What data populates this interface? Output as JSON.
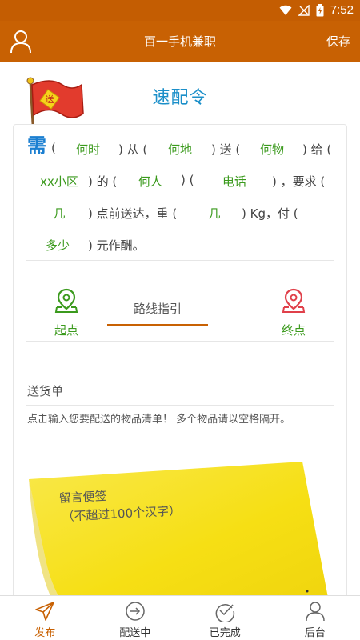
{
  "status_bar": {
    "time": "7:52",
    "icons": [
      "wifi-icon",
      "signal-off-icon",
      "battery-charging-icon"
    ]
  },
  "header": {
    "title": "百一手机兼职",
    "save_label": "保存",
    "user_icon": "user-icon"
  },
  "page": {
    "title": "速配令",
    "flag_char": "送",
    "need_char": "需"
  },
  "order_form": {
    "open_paren": "(",
    "from_text": ") 从 (",
    "send_text": ") 送 (",
    "give_text": ") 给 (",
    "of_text": ") 的 (",
    "paren_mid": ") (",
    "require_text": ") ，要求 (",
    "deliver_text": ") 点前送达，重 (",
    "weight_unit_text": ") Kg，付 (",
    "reward_text": ") 元作酬。",
    "slots": {
      "when": "何时",
      "where": "何地",
      "what": "何物",
      "community": "xx小区",
      "who": "何人",
      "phone": "电话",
      "hour": "几",
      "weight": "几",
      "pay": "多少"
    }
  },
  "route": {
    "start_label": "起点",
    "title": "路线指引",
    "end_label": "终点"
  },
  "delivery": {
    "label": "送货单",
    "hint": "点击输入您要配送的物品清单！ 多个物品请以空格隔开。"
  },
  "note": {
    "title": "留言便签",
    "subtitle": "（不超过100个汉字）"
  },
  "bottom_nav": [
    {
      "label": "发布",
      "icon": "send-icon",
      "active": true
    },
    {
      "label": "配送中",
      "icon": "arrow-circle-icon",
      "active": false
    },
    {
      "label": "已完成",
      "icon": "check-circle-icon",
      "active": false
    },
    {
      "label": "后台",
      "icon": "user-icon",
      "active": false
    }
  ],
  "colors": {
    "brand": "#c86103",
    "title_blue": "#1b8fc9",
    "slot_green": "#3b9a1d",
    "end_pin_red": "#e0404a",
    "sticky_yellow": "#f8e51a"
  }
}
